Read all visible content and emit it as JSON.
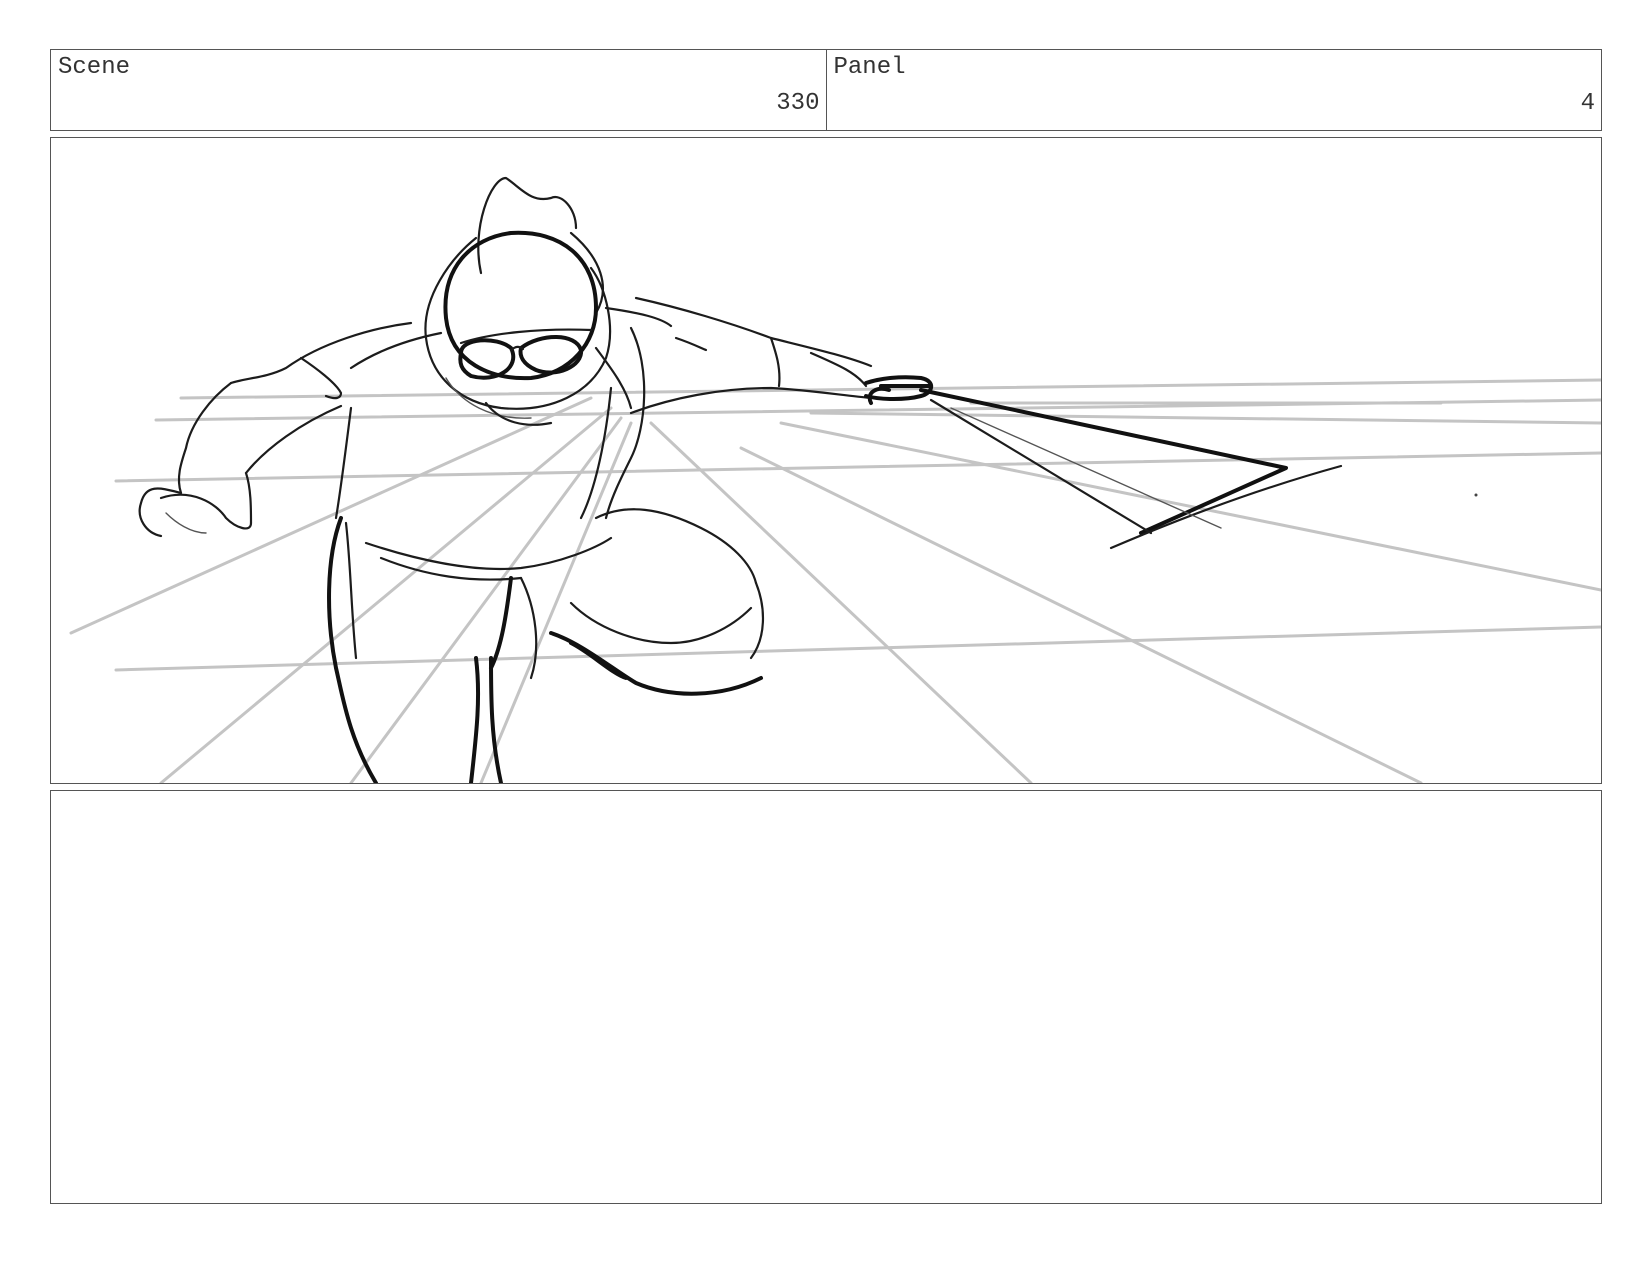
{
  "header": {
    "scene": {
      "label": "Scene",
      "value": "330"
    },
    "panel": {
      "label": "Panel",
      "value": "4"
    }
  },
  "frame": {
    "content": "pencil-sketch"
  },
  "notes": {
    "text": ""
  }
}
